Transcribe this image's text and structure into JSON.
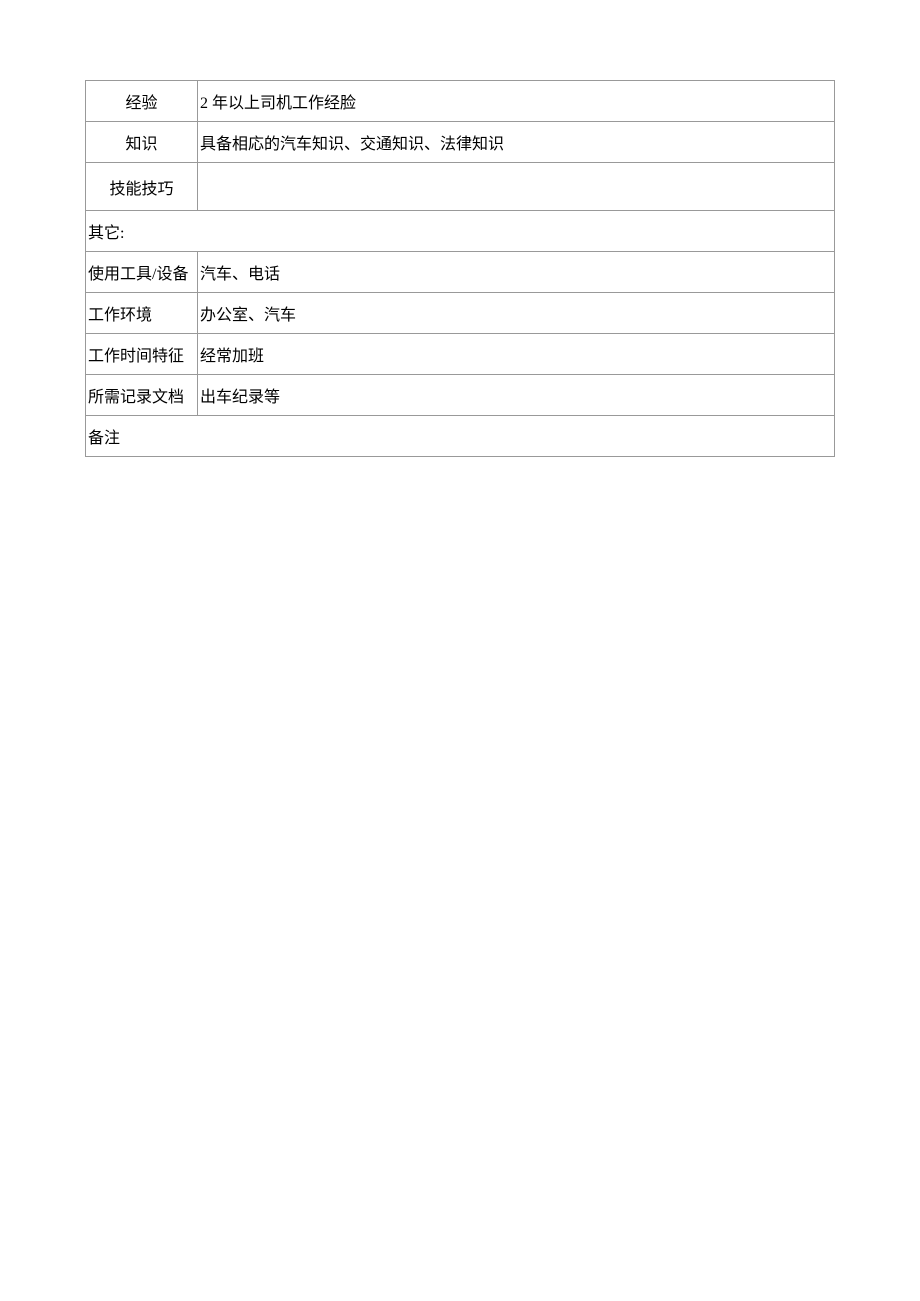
{
  "rows": {
    "experience": {
      "label": "经验",
      "value": "2 年以上司机工作经脸"
    },
    "knowledge": {
      "label": "知识",
      "value": "具备相応的汽车知识、交通知识、法律知识"
    },
    "skills": {
      "label": "技能技巧",
      "value": ""
    },
    "other": {
      "label": "其它:"
    },
    "tools": {
      "label": "使用工具/设备",
      "value": "汽车、电话"
    },
    "environment": {
      "label": "工作环境",
      "value": "办公室、汽车"
    },
    "timeFeatures": {
      "label": "工作时间特征",
      "value": "经常加班"
    },
    "records": {
      "label": "所需记录文档",
      "value": "出车纪录等"
    },
    "remarks": {
      "label": "备注"
    }
  }
}
